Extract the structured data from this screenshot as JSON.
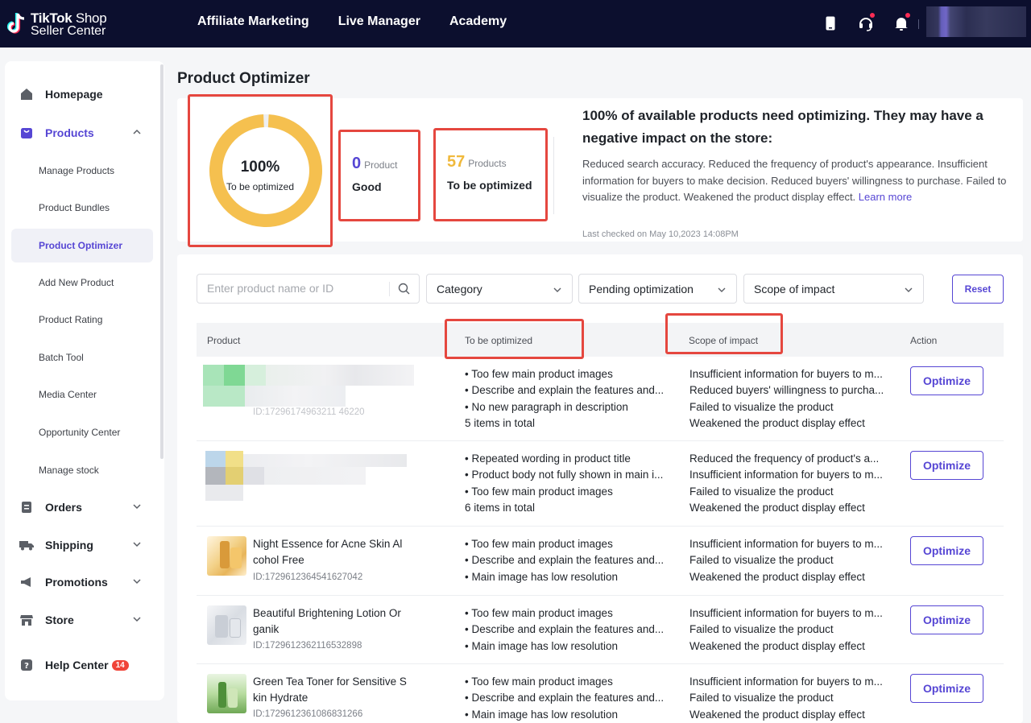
{
  "header": {
    "logo_brand": "TikTok",
    "logo_shop": "Shop",
    "logo_line2": "Seller Center",
    "nav": [
      "Affiliate Marketing",
      "Live Manager",
      "Academy"
    ]
  },
  "sidebar": {
    "homepage": "Homepage",
    "products": "Products",
    "products_sub": [
      "Manage Products",
      "Product Bundles",
      "Product Optimizer",
      "Add New Product",
      "Product Rating",
      "Batch Tool",
      "Media Center",
      "Opportunity Center",
      "Manage stock"
    ],
    "orders": "Orders",
    "shipping": "Shipping",
    "promotions": "Promotions",
    "store": "Store",
    "help": "Help Center",
    "help_badge": "14"
  },
  "page": {
    "title": "Product Optimizer"
  },
  "summary": {
    "donut_pct": "100%",
    "donut_label": "To be optimized",
    "donut_fraction": 1.0,
    "good_count": "0",
    "good_unit": "Product",
    "good_label": "Good",
    "opt_count": "57",
    "opt_unit": "Products",
    "opt_label": "To be optimized",
    "warn_title": "100% of available products need optimizing. They may have a negative impact on the store:",
    "warn_body": "Reduced search accuracy. Reduced the frequency of product's appearance. Insufficient information for buyers to make decision. Reduced buyers' willingness to purchase. Failed to visualize the product. Weakened the product display effect. ",
    "learn_more": "Learn more",
    "last_checked": "Last checked on May 10,2023 14:08PM"
  },
  "filters": {
    "search_placeholder": "Enter product name or ID",
    "category": "Category",
    "status": "Pending optimization",
    "scope": "Scope of impact",
    "reset": "Reset"
  },
  "table": {
    "headers": {
      "product": "Product",
      "to_opt": "To be optimized",
      "scope": "Scope of impact",
      "action": "Action"
    },
    "optimize_label": "Optimize",
    "rows": [
      {
        "name": "",
        "id": "ID:17296174963211 46220",
        "issues": [
          "• Too few main product images",
          "• Describe and explain the features and...",
          "• No new paragraph in description",
          "5 items in total"
        ],
        "impacts": [
          "Insufficient information for buyers to m...",
          "Reduced buyers' willingness to purcha...",
          "Failed to visualize the product",
          "Weakened the product display effect"
        ]
      },
      {
        "name": "",
        "id": "",
        "issues": [
          "• Repeated wording in product title",
          "• Product body not fully shown in main i...",
          "• Too few main product images",
          "6 items in total"
        ],
        "impacts": [
          "Reduced the frequency of product's a...",
          "Insufficient information for buyers to m...",
          "Failed to visualize the product",
          "Weakened the product display effect"
        ]
      },
      {
        "name": "Night Essence for Acne Skin Al cohol Free",
        "id": "ID:1729612364541627042",
        "issues": [
          "• Too few main product images",
          "• Describe and explain the features and...",
          "• Main image has low resolution"
        ],
        "impacts": [
          "Insufficient information for buyers to m...",
          "Failed to visualize the product",
          "Weakened the product display effect"
        ]
      },
      {
        "name": "Beautiful Brightening Lotion Or ganik",
        "id": "ID:1729612362116532898",
        "issues": [
          "• Too few main product images",
          "• Describe and explain the features and...",
          "• Main image has low resolution"
        ],
        "impacts": [
          "Insufficient information for buyers to m...",
          "Failed to visualize the product",
          "Weakened the product display effect"
        ]
      },
      {
        "name": "Green Tea Toner for Sensitive S kin Hydrate",
        "id": "ID:1729612361086831266",
        "issues": [
          "• Too few main product images",
          "• Describe and explain the features and...",
          "• Main image has low resolution"
        ],
        "impacts": [
          "Insufficient information for buyers to m...",
          "Failed to visualize the product",
          "Weakened the product display effect"
        ]
      }
    ]
  },
  "colors": {
    "accent": "#5646d4",
    "donut": "#f5c04f",
    "annotation": "#e5473f",
    "topbar": "#0c0f2e"
  }
}
